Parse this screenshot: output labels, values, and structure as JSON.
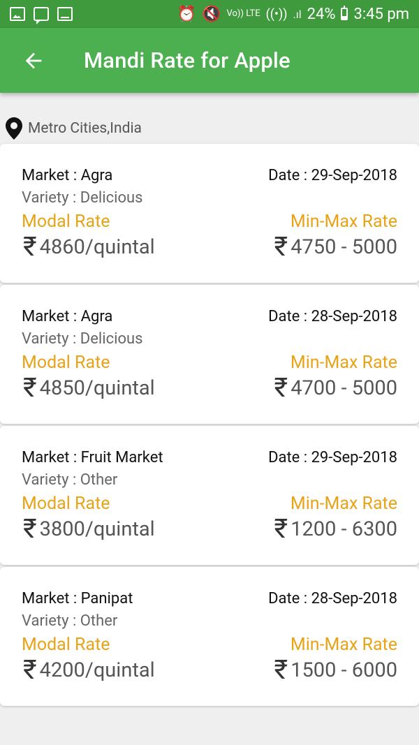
{
  "status_bar": {
    "battery": "24%",
    "time": "3:45 pm",
    "volte": "Vo)) LTE"
  },
  "app_bar": {
    "title": "Mandi Rate for Apple"
  },
  "location": {
    "text": "Metro Cities,India"
  },
  "currency_symbol": "₹",
  "cards": [
    {
      "market": "Market : Agra",
      "date": "Date : 29-Sep-2018",
      "variety": "Variety : Delicious",
      "modal_label": "Modal Rate",
      "modal_value": "4860/quintal",
      "minmax_label": "Min-Max Rate",
      "minmax_value": "4750 - 5000"
    },
    {
      "market": "Market : Agra",
      "date": "Date : 28-Sep-2018",
      "variety": "Variety : Delicious",
      "modal_label": "Modal Rate",
      "modal_value": "4850/quintal",
      "minmax_label": "Min-Max Rate",
      "minmax_value": "4700 - 5000"
    },
    {
      "market": "Market : Fruit Market",
      "date": "Date : 29-Sep-2018",
      "variety": "Variety : Other",
      "modal_label": "Modal Rate",
      "modal_value": "3800/quintal",
      "minmax_label": "Min-Max Rate",
      "minmax_value": "1200 - 6300"
    },
    {
      "market": "Market : Panipat",
      "date": "Date : 28-Sep-2018",
      "variety": "Variety : Other",
      "modal_label": "Modal Rate",
      "modal_value": "4200/quintal",
      "minmax_label": "Min-Max Rate",
      "minmax_value": "1500 - 6000"
    }
  ],
  "colors": {
    "status_bar": "#3f9a3d",
    "app_bar": "#4caf50",
    "accent_label": "#e8a317",
    "background": "#efefef"
  }
}
